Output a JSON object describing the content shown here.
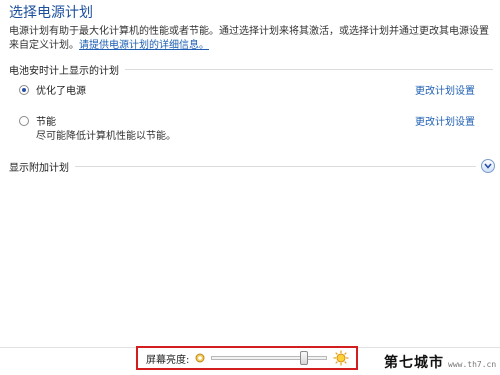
{
  "page": {
    "title": "选择电源计划",
    "description": "电源计划有助于最大化计算机的性能或者节能。通过选择计划来将其激活，或选择计划并通过更改其电源设置来自定义计划。",
    "help_link": "请提供电源计划的详细信息。"
  },
  "battery_section": {
    "label": "电池安时计上显示的计划"
  },
  "plans": [
    {
      "name": "优化了电源",
      "selected": true,
      "change_link": "更改计划设置"
    },
    {
      "name": "节能",
      "selected": false,
      "description": "尽可能降低计算机性能以节能。",
      "change_link": "更改计划设置"
    }
  ],
  "additional": {
    "label": "显示附加计划",
    "expand_icon": "chevron-down-icon"
  },
  "brightness": {
    "label": "屏幕亮度:",
    "level_percent": 80,
    "dim_icon": "sun-dim-icon",
    "bright_icon": "sun-bright-icon",
    "highlight_color": "#d21e1e"
  },
  "watermark": {
    "text": "第七城市",
    "url": "www.th7.cn"
  },
  "colors": {
    "title": "#1b4f9c",
    "link": "#1e5fb3"
  }
}
